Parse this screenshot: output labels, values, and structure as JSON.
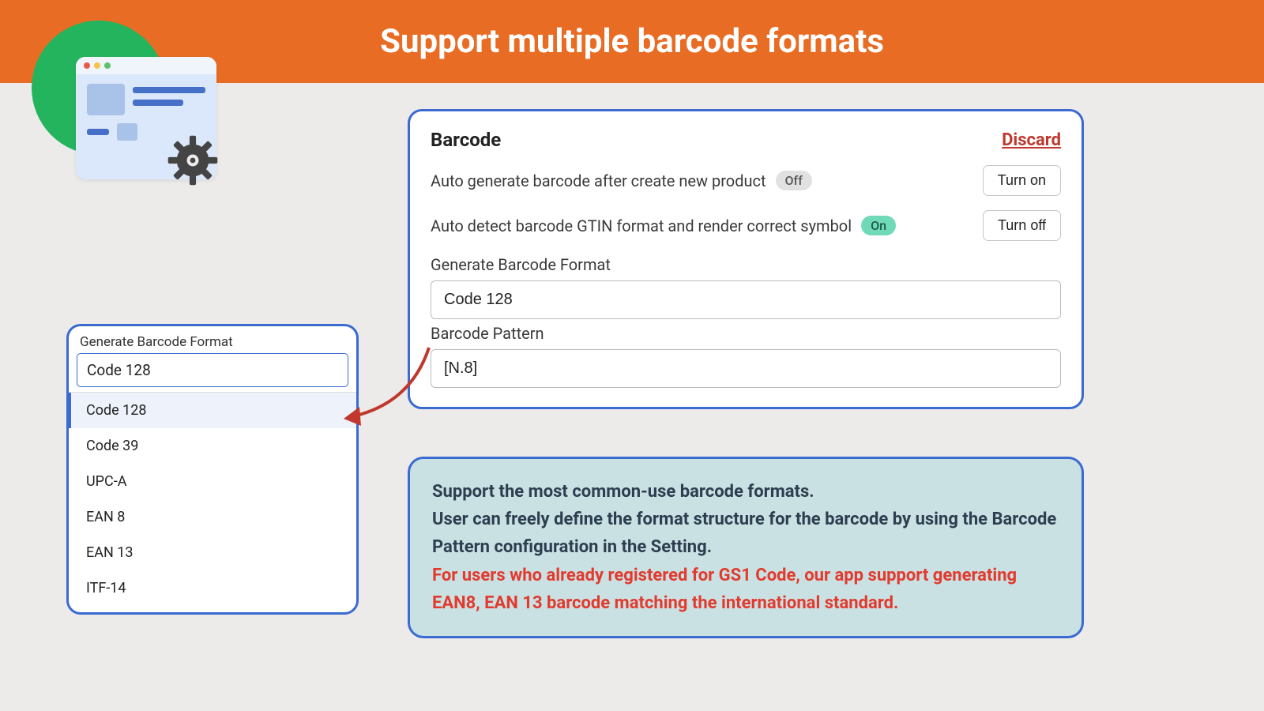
{
  "header": {
    "title": "Support multiple barcode formats"
  },
  "barcode_panel": {
    "title": "Barcode",
    "discard": "Discard",
    "auto_gen": {
      "label": "Auto generate barcode after create new product",
      "badge": "Off",
      "button": "Turn on"
    },
    "auto_detect": {
      "label": "Auto detect barcode GTIN format and render correct symbol",
      "badge": "On",
      "button": "Turn off"
    },
    "format": {
      "label": "Generate Barcode Format",
      "value": "Code 128"
    },
    "pattern": {
      "label": "Barcode Pattern",
      "value": "[N.8]"
    }
  },
  "dropdown": {
    "label": "Generate Barcode Format",
    "value": "Code 128",
    "options": [
      "Code 128",
      "Code 39",
      "UPC-A",
      "EAN 8",
      "EAN 13",
      "ITF-14"
    ]
  },
  "info": {
    "line1": "Support the most common-use barcode formats.",
    "line2": "User can freely define the format structure for the barcode by using the Barcode Pattern configuration in the Setting.",
    "line3": "For users who already registered for GS1 Code, our app support generating EAN8, EAN 13 barcode matching the international standard."
  }
}
